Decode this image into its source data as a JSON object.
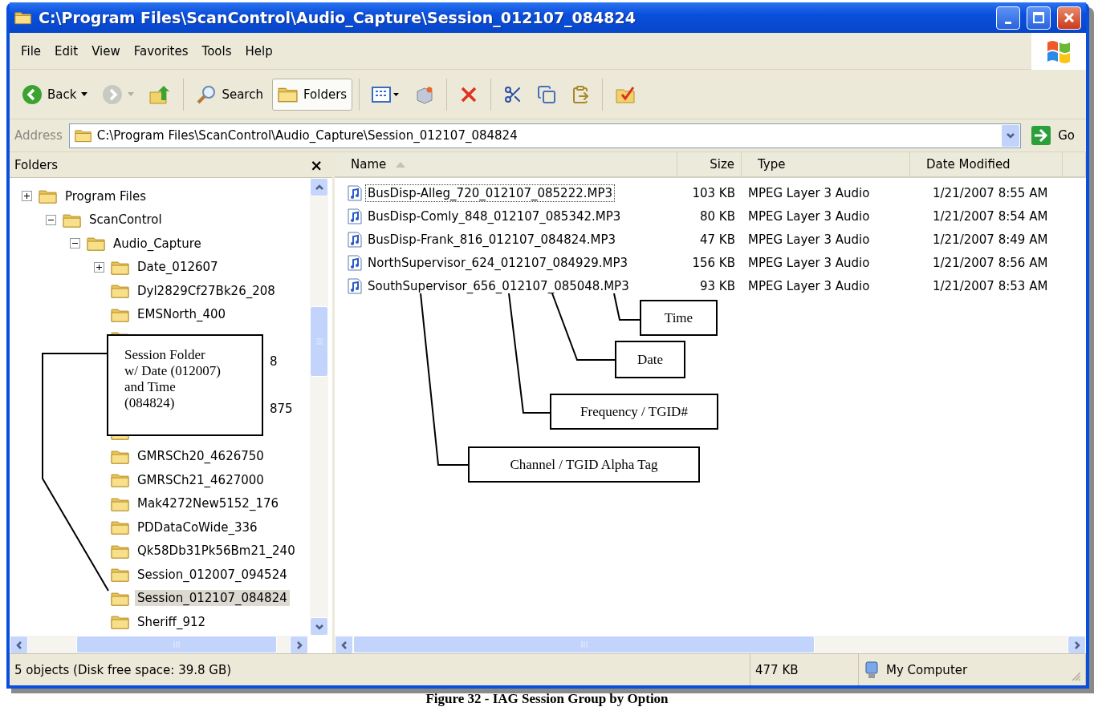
{
  "window": {
    "title": "C:\\Program Files\\ScanControl\\Audio_Capture\\Session_012107_084824"
  },
  "menu": [
    "File",
    "Edit",
    "View",
    "Favorites",
    "Tools",
    "Help"
  ],
  "toolbar": {
    "back_label": "Back",
    "search_label": "Search",
    "folders_label": "Folders",
    "folders_pressed": true,
    "forward_disabled": true
  },
  "address": {
    "label": "Address",
    "value": "C:\\Program Files\\ScanControl\\Audio_Capture\\Session_012107_084824",
    "go_label": "Go"
  },
  "folders_pane": {
    "title": "Folders",
    "close": "×",
    "tree": [
      {
        "label": "Program Files",
        "expanded": false,
        "selected": false,
        "children": [
          {
            "label": "ScanControl",
            "expanded": true,
            "selected": false,
            "children": [
              {
                "label": "Audio_Capture",
                "expanded": true,
                "selected": false,
                "children": [
                  {
                    "label": "Date_012607",
                    "expanded": false,
                    "selected": false
                  },
                  {
                    "label": "Dyl2829Cf27Bk26_208",
                    "selected": false
                  },
                  {
                    "label": "EMSNorth_400",
                    "selected": false
                  },
                  {
                    "kind": "partial"
                  },
                  {
                    "kind": "covered",
                    "tail": "8"
                  },
                  {
                    "kind": "covered"
                  },
                  {
                    "kind": "covered",
                    "tail": "875"
                  },
                  {
                    "kind": "partial"
                  },
                  {
                    "label": "GMRSCh20_4626750",
                    "selected": false
                  },
                  {
                    "label": "GMRSCh21_4627000",
                    "selected": false
                  },
                  {
                    "label": "Mak4272New5152_176",
                    "selected": false
                  },
                  {
                    "label": "PDDataCoWide_336",
                    "selected": false
                  },
                  {
                    "label": "Qk58Db31Pk56Bm21_240",
                    "selected": false
                  },
                  {
                    "label": "Session_012007_094524",
                    "selected": false
                  },
                  {
                    "label": "Session_012107_084824",
                    "selected": true
                  },
                  {
                    "label": "Sheriff_912",
                    "selected": false
                  }
                ]
              }
            ]
          }
        ]
      }
    ]
  },
  "file_list": {
    "columns": [
      {
        "label": "Name",
        "sorted": true
      },
      {
        "label": "Size",
        "sorted": false
      },
      {
        "label": "Type",
        "sorted": false
      },
      {
        "label": "Date Modified",
        "sorted": false
      }
    ],
    "rows": [
      {
        "name": "BusDisp-Alleg_720_012107_085222.MP3",
        "size": "103 KB",
        "type": "MPEG Layer 3 Audio",
        "modified": "1/21/2007 8:55 AM",
        "focused": true
      },
      {
        "name": "BusDisp-Comly_848_012107_085342.MP3",
        "size": "80 KB",
        "type": "MPEG Layer 3 Audio",
        "modified": "1/21/2007 8:54 AM",
        "focused": false
      },
      {
        "name": "BusDisp-Frank_816_012107_084824.MP3",
        "size": "47 KB",
        "type": "MPEG Layer 3 Audio",
        "modified": "1/21/2007 8:49 AM",
        "focused": false
      },
      {
        "name": "NorthSupervisor_624_012107_084929.MP3",
        "size": "156 KB",
        "type": "MPEG Layer 3 Audio",
        "modified": "1/21/2007 8:56 AM",
        "focused": false
      },
      {
        "name": "SouthSupervisor_656_012107_085048.MP3",
        "size": "93 KB",
        "type": "MPEG Layer 3 Audio",
        "modified": "1/21/2007 8:53 AM",
        "focused": false
      }
    ]
  },
  "status_bar": {
    "summary": "5 objects (Disk free space: 39.8 GB)",
    "size": "477 KB",
    "zone": "My Computer"
  },
  "annotations": {
    "folder_callout": "Session Folder\nw/ Date (012007)\nand Time\n(084824)",
    "labels": [
      "Time",
      "Date",
      "Frequency / TGID#",
      "Channel / TGID Alpha Tag"
    ]
  },
  "caption": "Figure 32 - IAG Session Group by Option"
}
